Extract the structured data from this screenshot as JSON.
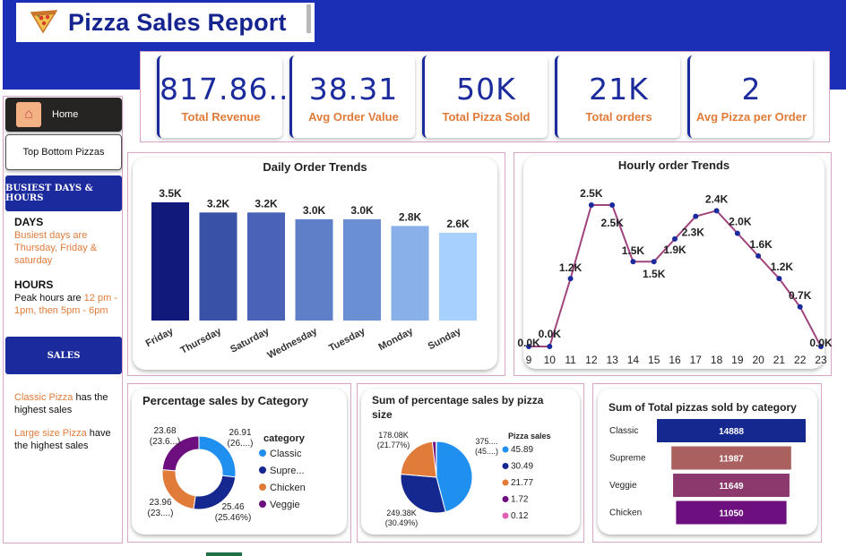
{
  "header": {
    "title": "Pizza Sales Report",
    "logo_icon": "pizza-icon",
    "band_color": "#1a2fb5"
  },
  "kpis": [
    {
      "value": "817.86..",
      "label": "Total Revenue"
    },
    {
      "value": "38.31",
      "label": "Avg Order Value"
    },
    {
      "value": "50K",
      "label": "Total Pizza Sold"
    },
    {
      "value": "21K",
      "label": "Total orders"
    },
    {
      "value": "2",
      "label": "Avg Pizza per Order"
    }
  ],
  "sidebar": {
    "home_label": "Home",
    "home_icon": "home-icon",
    "top_bottom_label": "Top Bottom Pizzas",
    "busiest_header": "BUSIEST DAYS & HOURS",
    "days_heading": "DAYS",
    "days_line1": "Busiest days are",
    "days_line2": "Thursday, Friday &",
    "days_line3": "saturday",
    "hours_heading": "HOURS",
    "hours_pre": "Peak hours are ",
    "hours_hl1": "12 pm -",
    "hours_hl2": "1pm,  then 5pm - 6pm",
    "sales_header": "SALES",
    "sales1_hl": "Classic Pizza",
    "sales1_rest": " has the",
    "sales1_line2": "highest sales",
    "sales2_hl": "Large size Pizza",
    "sales2_rest": " have",
    "sales2_line2": "the  highest sales"
  },
  "charts": {
    "daily": {
      "type": "bar",
      "title": "Daily Order Trends",
      "categories": [
        "Friday",
        "Thursday",
        "Saturday",
        "Wednesday",
        "Tuesday",
        "Monday",
        "Sunday"
      ],
      "values": [
        3.5,
        3.2,
        3.2,
        3.0,
        3.0,
        2.8,
        2.6
      ],
      "labels": [
        "3.5K",
        "3.2K",
        "3.2K",
        "3.0K",
        "3.0K",
        "2.8K",
        "2.6K"
      ],
      "colors": [
        "#111a7a",
        "#3a51a8",
        "#4a63b8",
        "#5f80c8",
        "#6b8fd3",
        "#8ab0ea",
        "#a7d0ff"
      ],
      "ylim": [
        0,
        3.5
      ]
    },
    "hourly": {
      "type": "line",
      "title": "Hourly order Trends",
      "x": [
        9,
        10,
        11,
        12,
        13,
        14,
        15,
        16,
        17,
        18,
        19,
        20,
        21,
        22,
        23
      ],
      "values": [
        0.0,
        0.0,
        1.2,
        2.5,
        2.5,
        1.5,
        1.5,
        1.9,
        2.3,
        2.4,
        2.0,
        1.6,
        1.2,
        0.7,
        0.0
      ],
      "labels": [
        "0.0K",
        "0.0K",
        "1.2K",
        "2.5K",
        "2.5K",
        "1.5K",
        "1.5K",
        "1.9K",
        "2.3K",
        "2.4K",
        "2.0K",
        "1.6K",
        "1.2K",
        "0.7K",
        "0.0K"
      ],
      "line_color": "#a0447e",
      "marker_color": "#1b2a9c",
      "ylim": [
        0,
        2.5
      ]
    },
    "category_donut": {
      "type": "pie",
      "title": "Percentage sales by Category",
      "legend_title": "category",
      "categories": [
        "Classic",
        "Supre...",
        "Chicken",
        "Veggie"
      ],
      "values": [
        26.91,
        25.46,
        23.96,
        23.68
      ],
      "colors": [
        "#1f8ff0",
        "#14288f",
        "#e07b39",
        "#6d0f7e"
      ],
      "slice_labels": [
        {
          "line1": "26.91",
          "line2": "(26....)"
        },
        {
          "line1": "25.46",
          "line2": "(25.46%)"
        },
        {
          "line1": "23.96",
          "line2": "(23....)"
        },
        {
          "line1": "23.68",
          "line2": "(23.6...)"
        }
      ]
    },
    "size_pie": {
      "type": "pie",
      "title_line1": "Sum of percentage sales by pizza",
      "title_line2": "size",
      "legend_title": "Pizza sales",
      "legend": [
        "45.89",
        "30.49",
        "21.77",
        "1.72",
        "0.12"
      ],
      "values": [
        45.89,
        30.49,
        21.77,
        1.72,
        0.12
      ],
      "colors": [
        "#1f8ff0",
        "#14288f",
        "#e07b39",
        "#6d0f7e",
        "#e05fb4"
      ],
      "slice_labels": [
        {
          "line1": "375....",
          "line2": "(45....)"
        },
        {
          "line1": "249.38K",
          "line2": "(30.49%)"
        },
        {
          "line1": "178.08K",
          "line2": "(21.77%)"
        }
      ]
    },
    "funnel": {
      "type": "bar",
      "title": "Sum of Total pizzas sold by category",
      "categories": [
        "Classic",
        "Supreme",
        "Veggie",
        "Chicken"
      ],
      "values": [
        14888,
        11987,
        11649,
        11050
      ],
      "labels": [
        "14888",
        "11987",
        "11649",
        "11050"
      ],
      "colors": [
        "#14288f",
        "#a9605f",
        "#8c3a6e",
        "#6d0f7e"
      ]
    }
  }
}
